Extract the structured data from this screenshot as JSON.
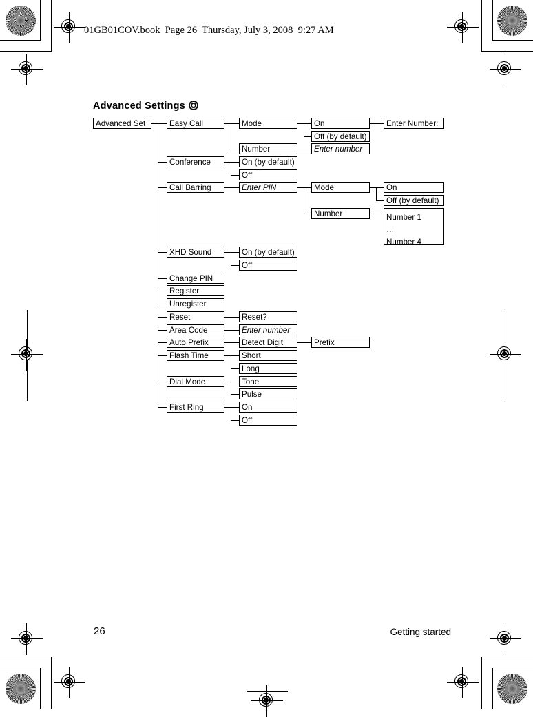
{
  "page": {
    "file_header": "01GB01COV.book  Page 26  Thursday, July 3, 2008  9:27 AM",
    "section_title": "Advanced Settings",
    "section_title_icon": "record-circle-icon",
    "footer_page_number": "26",
    "footer_section": "Getting started"
  },
  "diagram": {
    "name": "advanced-settings-menu-tree",
    "nodes": {
      "root": "Advanced Set",
      "easy_call": "Easy Call",
      "easy_call_mode": "Mode",
      "easy_call_mode_on": "On",
      "easy_call_mode_off": "Off (by default)",
      "easy_call_enter_number_prompt": "Enter Number:",
      "easy_call_number": "Number",
      "easy_call_number_entry": "Enter number",
      "conference": "Conference",
      "conference_on": "On (by default)",
      "conference_off": "Off",
      "call_barring": "Call Barring",
      "call_barring_pin": "Enter PIN",
      "call_barring_mode": "Mode",
      "call_barring_mode_on": "On",
      "call_barring_mode_off": "Off (by default)",
      "call_barring_number": "Number",
      "call_barring_number_list": "Number 1\n…\nNumber 4",
      "xhd_sound": "XHD Sound",
      "xhd_sound_on": "On (by default)",
      "xhd_sound_off": "Off",
      "change_pin": "Change PIN",
      "register": "Register",
      "unregister": "Unregister",
      "reset": "Reset",
      "reset_confirm": "Reset?",
      "area_code": "Area Code",
      "area_code_entry": "Enter number",
      "auto_prefix": "Auto Prefix",
      "auto_prefix_detect": "Detect Digit:",
      "auto_prefix_prefix": "Prefix",
      "flash_time": "Flash Time",
      "flash_time_short": "Short",
      "flash_time_long": "Long",
      "dial_mode": "Dial Mode",
      "dial_mode_tone": "Tone",
      "dial_mode_pulse": "Pulse",
      "first_ring": "First Ring",
      "first_ring_on": "On",
      "first_ring_off": "Off"
    }
  }
}
